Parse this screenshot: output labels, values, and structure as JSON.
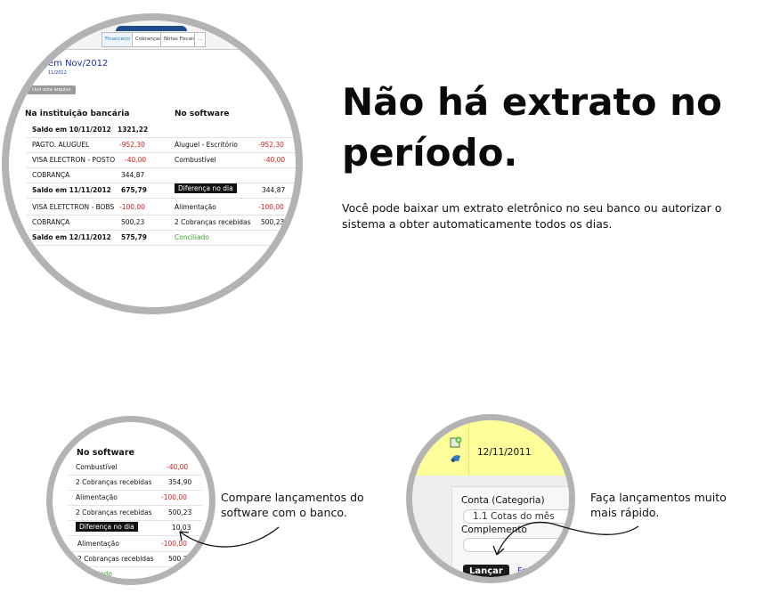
{
  "big_circle": {
    "tabs": [
      "Financeiro",
      "Cobranças",
      "Notas Fiscais",
      "..."
    ],
    "month_title": "em Nov/2012",
    "month_sub": "11/2012",
    "exclude_button": "cluir este arquivo",
    "header_bank": "Na instituição bancária",
    "header_software": "No software",
    "rows": [
      {
        "b_label": "Saldo em 10/11/2012",
        "b_value": "1321,22",
        "s_label": "",
        "s_value": "",
        "bold": true
      },
      {
        "b_label": "PAGTO. ALUGUEL",
        "b_value": "-952,30",
        "s_label": "Aluguel - Escritório",
        "s_value": "-952,30",
        "bold": false
      },
      {
        "b_label": "VISA ELECTRON - POSTO",
        "b_value": "-40,00",
        "s_label": "Combustível",
        "s_value": "-40,00",
        "bold": false
      },
      {
        "b_label": "COBRANÇA",
        "b_value": "344,87",
        "s_label": "",
        "s_value": "",
        "bold": false
      },
      {
        "b_label": "Saldo em 11/11/2012",
        "b_value": "675,79",
        "s_label": "Diferença no dia",
        "s_value": "344,87",
        "bold": true
      },
      {
        "b_label": "VISA ELETCTRON - BOBS",
        "b_value": "-100,00",
        "s_label": "Alimentação",
        "s_value": "-100,00",
        "bold": false
      },
      {
        "b_label": "COBRANÇA",
        "b_value": "500,23",
        "s_label": "2 Cobranças recebidas",
        "s_value": "500,23",
        "bold": false
      },
      {
        "b_label": "Saldo em 12/11/2012",
        "b_value": "575,79",
        "s_label": "Conciliado",
        "s_value": "",
        "bold": true
      }
    ]
  },
  "headline": {
    "line1": "Não há extrato no",
    "line2": "período.",
    "description": "Você pode baixar um extrato eletrônico no seu banco ou autorizar o sistema a obter automaticamente todos os dias."
  },
  "small_left": {
    "header": "No software",
    "rows": [
      {
        "label": "Combustível",
        "value": "-40,00"
      },
      {
        "label": "2 Cobranças recebidas",
        "value": "354,90"
      },
      {
        "label": "Alimentação",
        "value": "-100,00"
      },
      {
        "label": "2 Cobranças recebidas",
        "value": "500,23"
      },
      {
        "label": "Diferença no dia",
        "value": "10,03"
      },
      {
        "label": "Alimentação",
        "value": "-100,00"
      },
      {
        "label": "2 Cobranças recebidas",
        "value": "500,2"
      },
      {
        "label": "Conciliado",
        "value": ""
      }
    ],
    "caption_line1": "Compare lançamentos do",
    "caption_line2": "software com o banco."
  },
  "small_right": {
    "date": "12/11/2011",
    "conta_label": "Conta (Categoria)",
    "conta_value": "1.1 Cotas do mês",
    "complemento_label": "Complemento",
    "lancar_button": "Lançar",
    "fechar_link": "Fech",
    "caption_line1": "Faça lançamentos muito",
    "caption_line2": "mais rápido."
  },
  "colors": {
    "negative": "#d32020",
    "conciliado": "#3aa02a",
    "title_blue": "#1b2fa6",
    "yellow": "#fdfd9a",
    "ring": "#b3b3b3"
  }
}
